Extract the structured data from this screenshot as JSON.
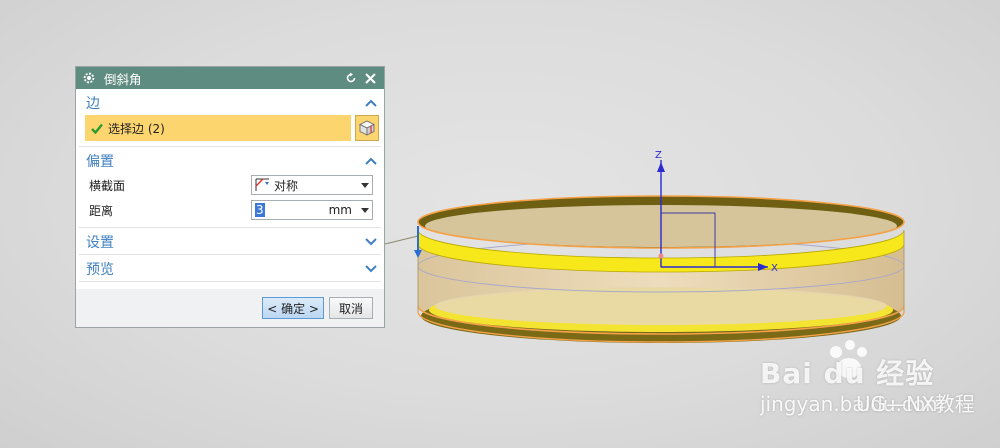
{
  "dialog": {
    "title": "倒斜角",
    "edge_section": {
      "label": "边",
      "select_label": "选择边 (2)"
    },
    "offset_section": {
      "label": "偏置",
      "cross_section_label": "横截面",
      "cross_section_value": "对称",
      "distance_label": "距离",
      "distance_value": "3",
      "distance_unit": "mm"
    },
    "settings_section": {
      "label": "设置"
    },
    "preview_section": {
      "label": "预览"
    },
    "ok_label": "< 确定 >",
    "cancel_label": "取消"
  },
  "viewport": {
    "axis_z": "Z",
    "axis_x": "X",
    "watermark_brand": "Bai du 经验",
    "watermark_url": "jingyan.baidu.com",
    "watermark_channel": "UG—NX教程"
  },
  "colors": {
    "title_bar": "#5f8c80",
    "section_label": "#3f7fbf",
    "selection_highlight": "#fdd56e",
    "chamfer_yellow": "#f7e81c",
    "edge_orange": "#f4a24a"
  },
  "icons": {
    "title": "gear-icon",
    "reset": "reset-icon",
    "close": "close-icon",
    "check": "checkmark-icon",
    "edge_picker": "cube-icon",
    "cross_section": "cross-section-icon"
  }
}
